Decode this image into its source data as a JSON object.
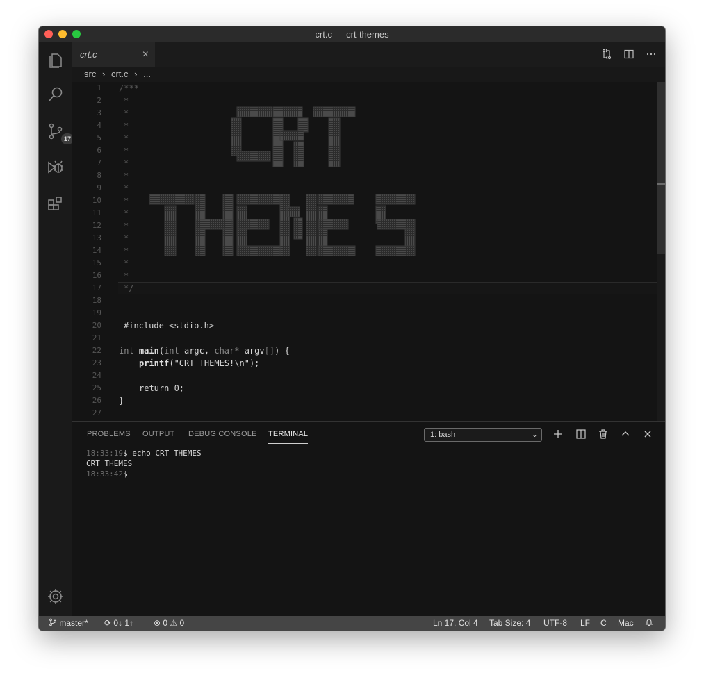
{
  "window": {
    "title": "crt.c — crt-themes"
  },
  "activity": {
    "scm_badge": "17"
  },
  "tab": {
    "label": "crt.c",
    "close": "×"
  },
  "breadcrumb": [
    "src",
    "›",
    "crt.c",
    "›",
    "..."
  ],
  "editor": {
    "line_numbers": [
      "1",
      "2",
      "3",
      "4",
      "5",
      "6",
      "7",
      "8",
      "9",
      "10",
      "11",
      "12",
      "13",
      "14",
      "15",
      "16",
      "17",
      "18",
      "19",
      "20",
      "21",
      "22",
      "23",
      "24",
      "25",
      "26",
      "27"
    ],
    "comment_open": "/***",
    "comment_star": "*",
    "comment_close": "*/",
    "include_line": "#include <stdio.h>",
    "main_sig": {
      "int": "int",
      "name": "main",
      "open": "(",
      "int2": "int",
      "argc": "argc,",
      "char": "char*",
      "argv": "argv",
      "brackets": "[]",
      "close": ") {"
    },
    "printf_line": {
      "fn": "printf",
      "args": "(\"CRT THEMES!\\n\");"
    },
    "return_line": "return 0;",
    "close_brace": "}",
    "ascii_art": [
      "CRT",
      "THEMES"
    ]
  },
  "panel": {
    "tabs": [
      "PROBLEMS",
      "OUTPUT",
      "DEBUG CONSOLE",
      "TERMINAL"
    ],
    "active_tab": "TERMINAL",
    "terminal_select": "1: bash",
    "terminal": [
      {
        "time": "18:33:19",
        "prompt": "$",
        "cmd": " echo CRT THEMES"
      },
      {
        "output": "CRT THEMES"
      },
      {
        "time": "18:33:42",
        "prompt": "$",
        "cmd": ""
      }
    ]
  },
  "status": {
    "branch": "master*",
    "sync": "0↓ 1↑",
    "errors": "0",
    "warnings": "0",
    "position": "Ln 17, Col 4",
    "tab_size": "Tab Size: 4",
    "encoding": "UTF-8",
    "eol": "LF",
    "language": "C",
    "keymap": "Mac"
  }
}
